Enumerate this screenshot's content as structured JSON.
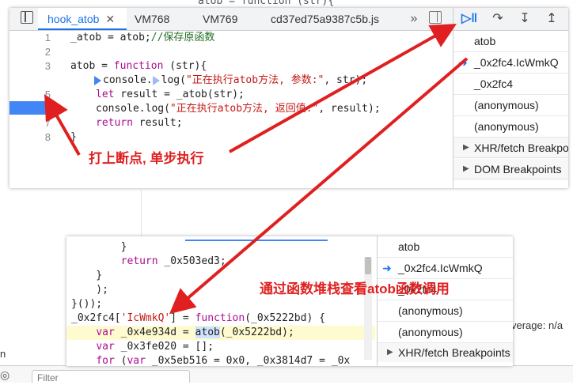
{
  "background": {
    "top_code": "atob = function (str){",
    "coverage": "verage: n/a",
    "filter_placeholder": "Filter",
    "left_char": "n"
  },
  "top_panel": {
    "tabs": [
      {
        "label": "hook_atob",
        "active": true,
        "closable": true
      },
      {
        "label": "VM768"
      },
      {
        "label": "VM769"
      },
      {
        "label": "cd37ed75a9387c5b.js"
      }
    ],
    "more_tabs": "»",
    "line_numbers": [
      "1",
      "2",
      "3",
      "4",
      "5",
      "6",
      "7",
      "8"
    ],
    "breakpoint_line": "4",
    "code_lines": [
      {
        "segments": [
          {
            "t": "_atob = atob;",
            "c": ""
          },
          {
            "t": "//保存原函数",
            "c": "cm"
          }
        ]
      },
      {
        "segments": [
          {
            "t": "",
            "c": ""
          }
        ]
      },
      {
        "segments": [
          {
            "t": "atob = ",
            "c": ""
          },
          {
            "t": "function",
            "c": "kw"
          },
          {
            "t": " (str){",
            "c": ""
          }
        ]
      },
      {
        "segments": [
          {
            "t": "console.",
            "c": ""
          },
          {
            "t": "log(",
            "c": ""
          },
          {
            "t": "\"正在执行atob方法, 参数:\"",
            "c": "str"
          },
          {
            "t": ", str);",
            "c": ""
          }
        ]
      },
      {
        "segments": [
          {
            "t": "let",
            "c": "kw"
          },
          {
            "t": " result = _atob(str);",
            "c": ""
          }
        ]
      },
      {
        "segments": [
          {
            "t": "console.log(",
            "c": ""
          },
          {
            "t": "\"正在执行atob方法, 返回值:\"",
            "c": "str"
          },
          {
            "t": ", result);",
            "c": ""
          }
        ]
      },
      {
        "segments": [
          {
            "t": "return",
            "c": "kw"
          },
          {
            "t": " result;",
            "c": ""
          }
        ]
      },
      {
        "segments": [
          {
            "t": "}",
            "c": ""
          }
        ]
      }
    ],
    "call_stack": [
      {
        "label": "atob",
        "current": false
      },
      {
        "label": "_0x2fc4.IcWmkQ",
        "current": true
      },
      {
        "label": "_0x2fc4",
        "current": false
      },
      {
        "label": "(anonymous)",
        "current": false
      },
      {
        "label": "(anonymous)",
        "current": false
      }
    ],
    "sections": [
      "XHR/fetch Breakpoints",
      "DOM Breakpoints"
    ],
    "debug_buttons": [
      "resume-icon",
      "step-over-icon",
      "step-into-icon",
      "step-out-icon"
    ]
  },
  "annotations": {
    "breakpoint_note": "打上断点, 单步执行",
    "stack_note": "通过函数堆栈查看atob函数调用"
  },
  "bottom_panel": {
    "code_lines": [
      {
        "segments": [
          {
            "t": "        }",
            "c": ""
          }
        ]
      },
      {
        "segments": [
          {
            "t": "        ",
            "c": ""
          },
          {
            "t": "return",
            "c": "kw"
          },
          {
            "t": " _0x503ed3;",
            "c": ""
          }
        ]
      },
      {
        "segments": [
          {
            "t": "    }",
            "c": ""
          }
        ]
      },
      {
        "segments": [
          {
            "t": "    );",
            "c": ""
          }
        ]
      },
      {
        "segments": [
          {
            "t": "}());",
            "c": ""
          }
        ]
      },
      {
        "segments": [
          {
            "t": "_0x2fc4[",
            "c": ""
          },
          {
            "t": "'IcWmkQ'",
            "c": "str"
          },
          {
            "t": "] = ",
            "c": ""
          },
          {
            "t": "function",
            "c": "kw"
          },
          {
            "t": "(_0x5222bd) {",
            "c": ""
          }
        ]
      },
      {
        "segments": [
          {
            "t": "    ",
            "c": ""
          },
          {
            "t": "var",
            "c": "kw"
          },
          {
            "t": " _0x4e934d = ",
            "c": ""
          },
          {
            "t": "atob",
            "c": "pb-atob"
          },
          {
            "t": "(_0x5222bd);",
            "c": ""
          }
        ]
      },
      {
        "segments": [
          {
            "t": "    ",
            "c": ""
          },
          {
            "t": "var",
            "c": "kw"
          },
          {
            "t": " _0x3fe020 = [];",
            "c": ""
          }
        ]
      },
      {
        "segments": [
          {
            "t": "    ",
            "c": ""
          },
          {
            "t": "for",
            "c": "kw"
          },
          {
            "t": " (",
            "c": ""
          },
          {
            "t": "var",
            "c": "kw"
          },
          {
            "t": " _0x5eb516 = 0x0, _0x3814d7 = _0x",
            "c": ""
          }
        ]
      }
    ],
    "call_stack": [
      {
        "label": "atob",
        "current": false
      },
      {
        "label": "_0x2fc4.IcWmkQ",
        "current": true
      },
      {
        "label": "_0x2fc4",
        "current": false
      },
      {
        "label": "(anonymous)",
        "current": false
      },
      {
        "label": "(anonymous)",
        "current": false
      }
    ],
    "sections": [
      "XHR/fetch Breakpoints"
    ]
  },
  "colors": {
    "accent": "#1a73e8",
    "breakpoint": "#4285f4",
    "annotation": "#e02020",
    "highlight_line": "#fffbd1"
  }
}
